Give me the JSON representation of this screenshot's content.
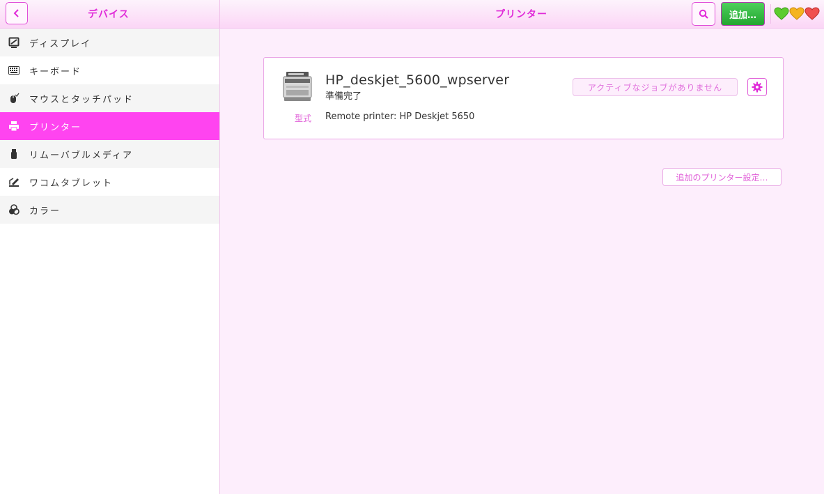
{
  "header": {
    "left_title": "デバイス",
    "center_title": "プリンター",
    "add_label": "追加…"
  },
  "sidebar": {
    "items": [
      {
        "label": "ディスプレイ",
        "icon": "display-icon"
      },
      {
        "label": "キーボード",
        "icon": "keyboard-icon"
      },
      {
        "label": "マウスとタッチパッド",
        "icon": "mouse-icon"
      },
      {
        "label": "プリンター",
        "icon": "printer-icon",
        "active": true
      },
      {
        "label": "リムーバブルメディア",
        "icon": "usb-drive-icon"
      },
      {
        "label": "ワコムタブレット",
        "icon": "tablet-pen-icon"
      },
      {
        "label": "カラー",
        "icon": "color-icon"
      }
    ]
  },
  "printer": {
    "name": "HP_deskjet_5600_wpserver",
    "status": "準備完了",
    "jobs_label": "アクティブなジョブがありません",
    "model_label": "型式",
    "model_value": "Remote printer: HP Deskjet 5650"
  },
  "more_settings_label": "追加のプリンター設定…",
  "colors": {
    "accent": "#ff44f0",
    "add_button": "#2fb03c"
  }
}
